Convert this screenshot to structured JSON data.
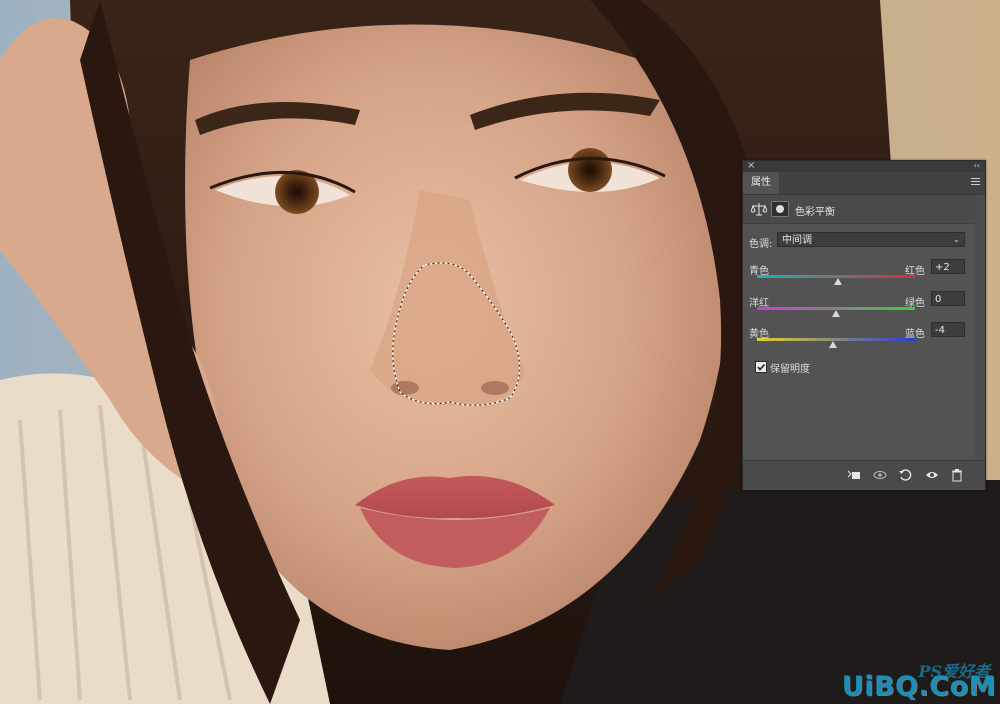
{
  "photo": {
    "subject": "portrait-photo",
    "selection": "nose-selection"
  },
  "panel": {
    "tab_label": "属性",
    "adjustment_title": "色彩平衡",
    "tone": {
      "label": "色调:",
      "value": "中间调"
    },
    "sliders": [
      {
        "left_label": "青色",
        "right_label": "红色",
        "value": "+2",
        "level": 2,
        "colors": [
          "#19b5b6",
          "#d2303b"
        ]
      },
      {
        "left_label": "洋红",
        "right_label": "绿色",
        "value": "0",
        "level": 0,
        "colors": [
          "#d13ad1",
          "#3ccc3c"
        ]
      },
      {
        "left_label": "黄色",
        "right_label": "蓝色",
        "value": "-4",
        "level": -4,
        "colors": [
          "#e0d22c",
          "#2b3bd6"
        ]
      }
    ],
    "slider_range": [
      -100,
      100
    ],
    "preserve_luminosity": {
      "label": "保留明度",
      "checked": true
    },
    "footer_icons": [
      "clip-to-layer-icon",
      "view-previous-icon",
      "reset-icon",
      "visibility-icon",
      "trash-icon"
    ]
  },
  "watermark": {
    "chinese": "PS爱好者",
    "site": "UiBQ.CoM"
  },
  "colors": {
    "panel_bg": "#535353",
    "panel_dark": "#3a3a3a",
    "watermark_blue": "#1d8fb7"
  }
}
